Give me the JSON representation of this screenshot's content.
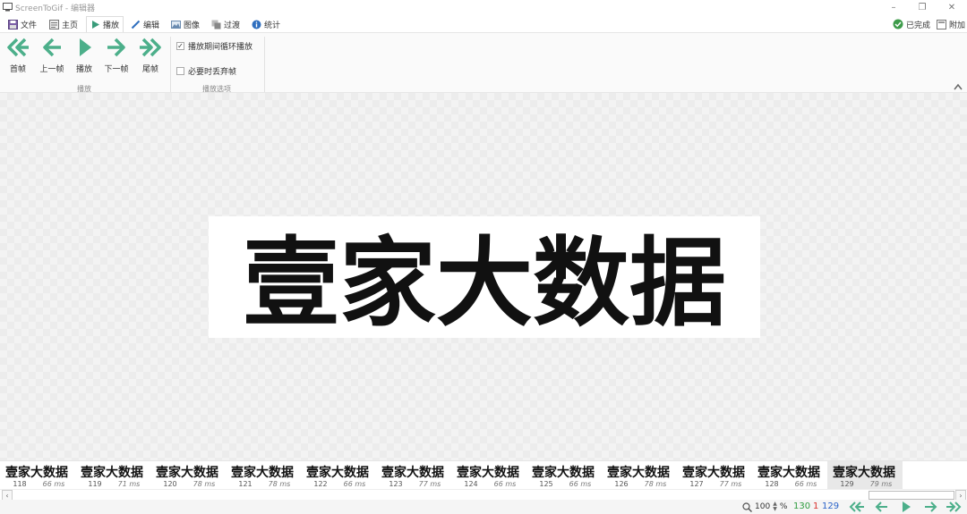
{
  "window": {
    "title": "ScreenToGif - 编辑器",
    "controls": [
      "–",
      "❐",
      "✕"
    ]
  },
  "menu": {
    "tabs": [
      {
        "label": "文件",
        "icon": "save-icon"
      },
      {
        "label": "主页",
        "icon": "home-icon"
      },
      {
        "label": "播放",
        "icon": "play-icon",
        "active": true
      },
      {
        "label": "编辑",
        "icon": "pencil-icon"
      },
      {
        "label": "图像",
        "icon": "image-icon"
      },
      {
        "label": "过渡",
        "icon": "transition-icon"
      },
      {
        "label": "统计",
        "icon": "info-icon"
      }
    ],
    "done_label": "已完成",
    "attach_label": "附加"
  },
  "ribbon": {
    "buttons": [
      {
        "label": "首帧",
        "icon": "double-arrow-left-icon"
      },
      {
        "label": "上一帧",
        "icon": "arrow-left-icon"
      },
      {
        "label": "播放",
        "icon": "play-icon"
      },
      {
        "label": "下一帧",
        "icon": "arrow-right-icon"
      },
      {
        "label": "尾帧",
        "icon": "double-arrow-right-icon"
      }
    ],
    "group_play_label": "播放",
    "options": [
      {
        "label": "播放期间循环播放",
        "checked": true
      },
      {
        "label": "必要时丢弃帧",
        "checked": false
      }
    ],
    "group_options_label": "播放选项"
  },
  "frame_text": "壹家大数据",
  "frames": [
    {
      "number": "118",
      "delay": "66 ms"
    },
    {
      "number": "119",
      "delay": "71 ms"
    },
    {
      "number": "120",
      "delay": "78 ms"
    },
    {
      "number": "121",
      "delay": "78 ms"
    },
    {
      "number": "122",
      "delay": "66 ms"
    },
    {
      "number": "123",
      "delay": "77 ms"
    },
    {
      "number": "124",
      "delay": "66 ms"
    },
    {
      "number": "125",
      "delay": "66 ms"
    },
    {
      "number": "126",
      "delay": "78 ms"
    },
    {
      "number": "127",
      "delay": "77 ms"
    },
    {
      "number": "128",
      "delay": "66 ms"
    },
    {
      "number": "129",
      "delay": "79 ms",
      "selected": true
    }
  ],
  "status": {
    "zoom": "100",
    "zoom_unit": "%",
    "frame_count": "130",
    "selected_count": "1",
    "current_frame": "129"
  },
  "colors": {
    "accent": "#2e86c1",
    "nav_green": "#4caf8a",
    "count_green": "#2e9c3e",
    "count_red": "#d9302c",
    "count_blue": "#2a63c9"
  }
}
